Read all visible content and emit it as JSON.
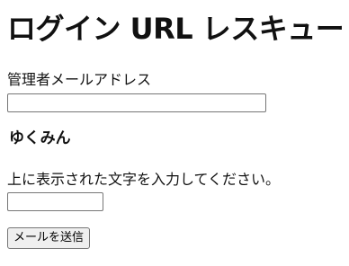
{
  "page": {
    "title": "ログイン URL レスキュー"
  },
  "form": {
    "email_label": "管理者メールアドレス",
    "email_value": "",
    "captcha_text": "ゆくみん",
    "captcha_instruction": "上に表示された文字を入力してください。",
    "captcha_value": "",
    "submit_label": "メールを送信"
  }
}
